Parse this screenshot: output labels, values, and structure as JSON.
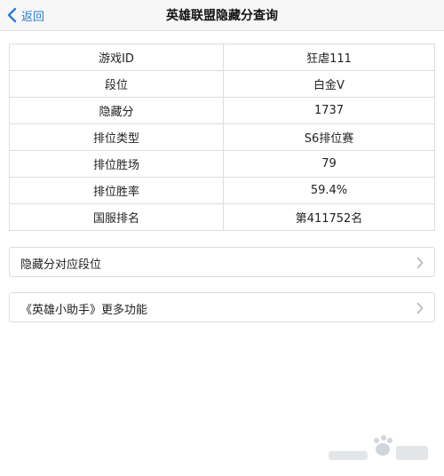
{
  "header": {
    "back_label": "返回",
    "title": "英雄联盟隐藏分查询"
  },
  "stats": [
    {
      "label": "游戏ID",
      "value": "狂虐111"
    },
    {
      "label": "段位",
      "value": "白金V"
    },
    {
      "label": "隐藏分",
      "value": "1737"
    },
    {
      "label": "排位类型",
      "value": "S6排位赛"
    },
    {
      "label": "排位胜场",
      "value": "79"
    },
    {
      "label": "排位胜率",
      "value": "59.4%"
    },
    {
      "label": "国服排名",
      "value": "第411752名"
    }
  ],
  "links": [
    {
      "label": "隐藏分对应段位"
    },
    {
      "label": "《英雄小助手》更多功能"
    }
  ],
  "colors": {
    "accent": "#2d7ad6",
    "border": "#dcdcdc",
    "chevron": "#bbbbbb"
  }
}
